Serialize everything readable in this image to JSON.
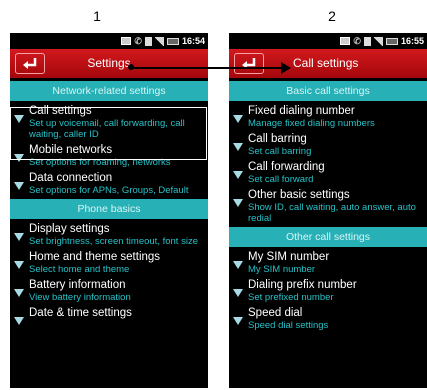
{
  "steps": [
    "1",
    "2"
  ],
  "status_time_1": "16:54",
  "status_time_2": "16:55",
  "screen1": {
    "title": "Settings",
    "sections": [
      {
        "header": "Network-related settings",
        "items": [
          {
            "title": "Call settings",
            "sub": "Set up voicemail, call forwarding, call waiting, caller ID"
          },
          {
            "title": "Mobile networks",
            "sub": "Set options for roaming, networks"
          },
          {
            "title": "Data connection",
            "sub": "Set options for APNs, Groups, Default"
          }
        ]
      },
      {
        "header": "Phone basics",
        "items": [
          {
            "title": "Display settings",
            "sub": "Set brightness, screen timeout, font size"
          },
          {
            "title": "Home and theme settings",
            "sub": "Select home and theme"
          },
          {
            "title": "Battery information",
            "sub": "View battery information"
          },
          {
            "title": "Date & time settings",
            "sub": ""
          }
        ]
      }
    ]
  },
  "screen2": {
    "title": "Call settings",
    "sections": [
      {
        "header": "Basic call settings",
        "items": [
          {
            "title": "Fixed dialing number",
            "sub": "Manage fixed dialing numbers"
          },
          {
            "title": "Call barring",
            "sub": "Set call barring"
          },
          {
            "title": "Call forwarding",
            "sub": "Set call forward"
          },
          {
            "title": "Other basic settings",
            "sub": "Show ID, call waiting, auto answer, auto redial"
          }
        ]
      },
      {
        "header": "Other call settings",
        "items": [
          {
            "title": "My SIM number",
            "sub": "My SIM number"
          },
          {
            "title": "Dialing prefix number",
            "sub": "Set prefixed number"
          },
          {
            "title": "Speed dial",
            "sub": "Speed dial settings"
          }
        ]
      }
    ]
  },
  "colors": {
    "titlebar": "#c0141a",
    "section": "#27b0b6",
    "subtitle": "#27c2c8"
  },
  "icons": [
    "back-arrow-icon",
    "mail-icon",
    "missed-call-icon",
    "sd-card-icon",
    "signal-icon",
    "battery-icon",
    "expand-arrow-icon"
  ]
}
